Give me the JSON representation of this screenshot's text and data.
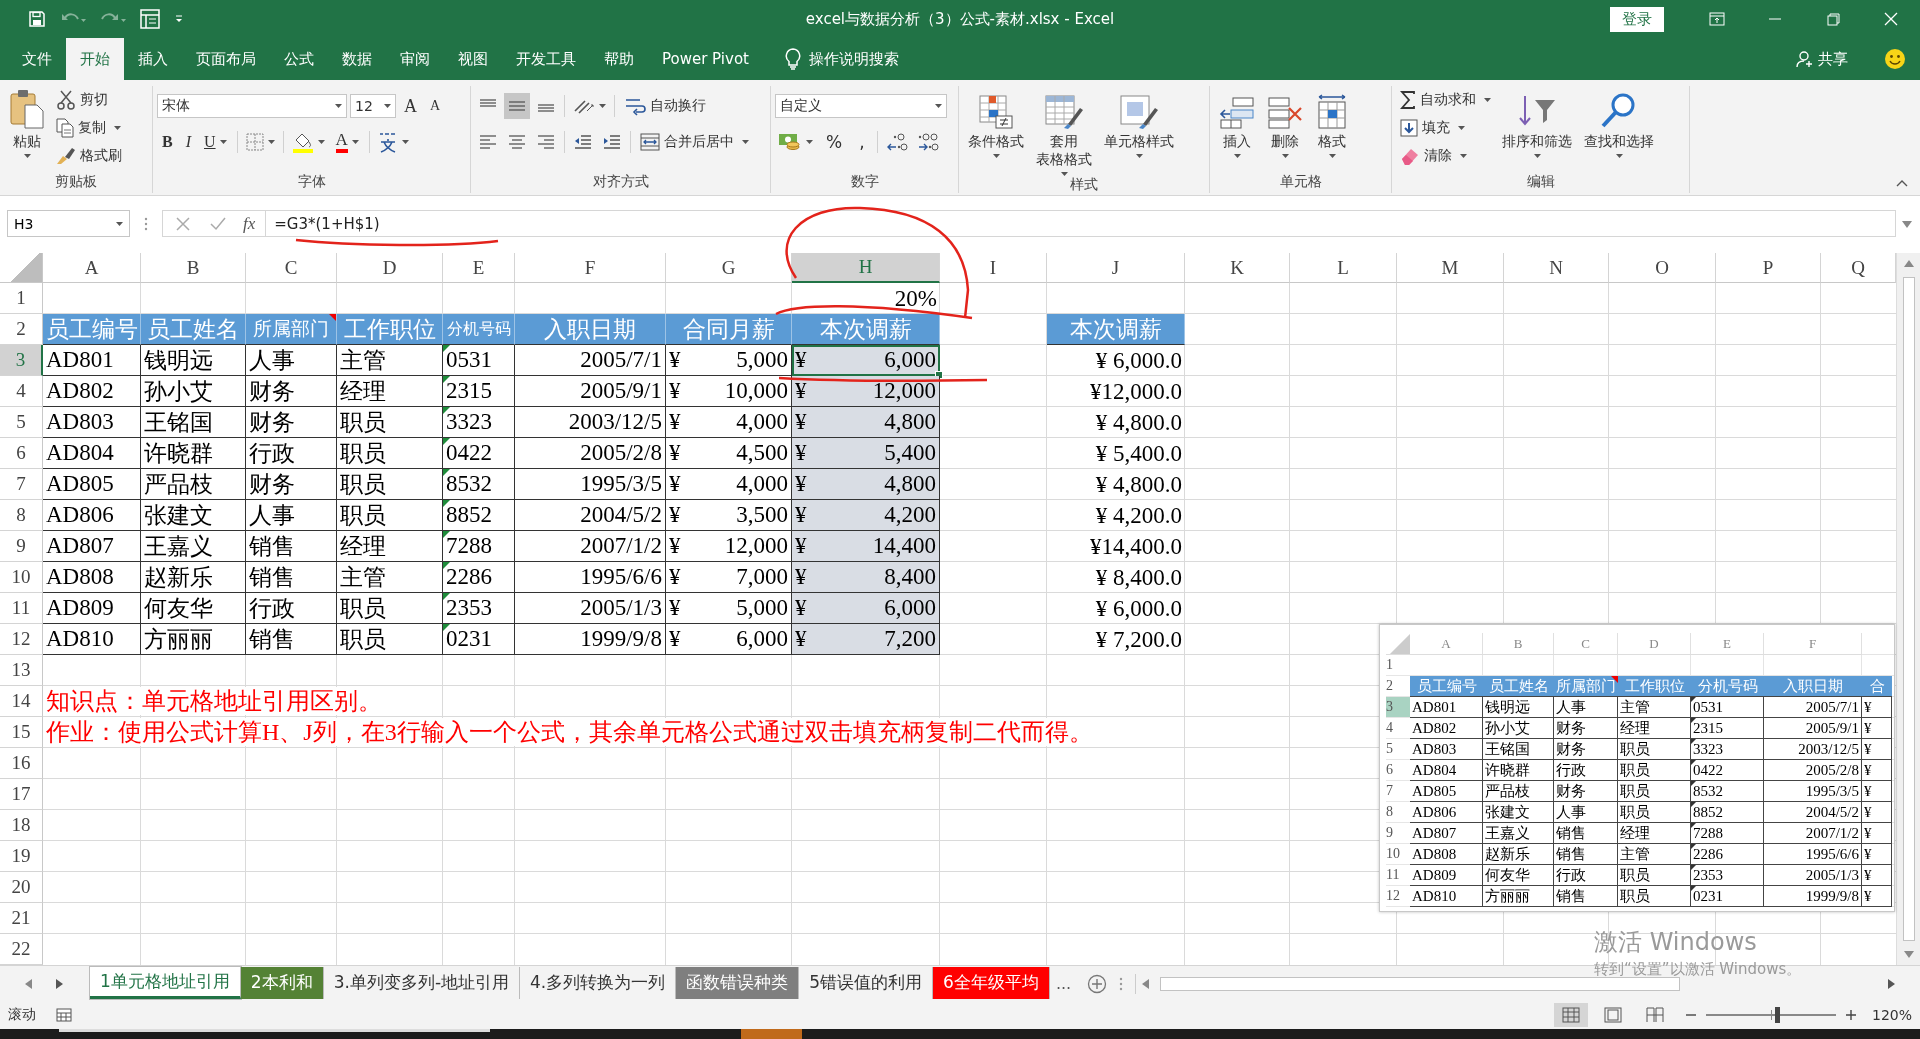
{
  "window": {
    "title": "excel与数据分析（3）公式-素材.xlsx  -  Excel",
    "sign_in": "登录"
  },
  "quick_access": [
    {
      "disabled": false
    },
    {
      "disabled": true
    },
    {
      "disabled": true
    },
    {
      "disabled": false
    }
  ],
  "menu_tabs": [
    {
      "label": "文件",
      "selected": false
    },
    {
      "label": "开始",
      "selected": true
    },
    {
      "label": "插入",
      "selected": false
    },
    {
      "label": "页面布局",
      "selected": false
    },
    {
      "label": "公式",
      "selected": false
    },
    {
      "label": "数据",
      "selected": false
    },
    {
      "label": "审阅",
      "selected": false
    },
    {
      "label": "视图",
      "selected": false
    },
    {
      "label": "开发工具",
      "selected": false
    },
    {
      "label": "帮助",
      "selected": false
    },
    {
      "label": "Power Pivot",
      "selected": false
    }
  ],
  "tell_me": "操作说明搜索",
  "share": "共享",
  "ribbon": {
    "clipboard": {
      "label": "剪贴板",
      "paste": "粘贴",
      "cut": "剪切",
      "copy": "复制",
      "format_painter": "格式刷"
    },
    "font": {
      "label": "字体",
      "font_name": "宋体",
      "font_size": "12",
      "grow": "A",
      "shrink": "A",
      "bold": "B",
      "italic": "I",
      "underline": "U",
      "font_color": "A"
    },
    "alignment": {
      "label": "对齐方式",
      "wrap_text": "自动换行",
      "merge_center": "合并后居中",
      "align_buttons": [
        {
          "selected": false
        },
        {
          "selected": true
        },
        {
          "selected": false
        },
        {
          "selected": false
        },
        {
          "selected": false
        },
        {
          "selected": false
        }
      ]
    },
    "number": {
      "label": "数字",
      "format": "自定义",
      "percent": "%",
      "comma": ","
    },
    "styles": {
      "label": "样式",
      "conditional": "条件格式",
      "table_format": [
        "套用",
        "表格格式"
      ],
      "cell_styles": "单元格样式"
    },
    "cells": {
      "label": "单元格",
      "insert": "插入",
      "delete": "删除",
      "format": "格式"
    },
    "editing": {
      "label": "编辑",
      "autosum": "自动求和",
      "fill": "填充",
      "clear": "清除",
      "sort_filter": "排序和筛选",
      "find_select": "查找和选择"
    }
  },
  "formula_bar": {
    "name_box": "H3",
    "function_label": "fx",
    "formula": "=G3*(1+H$1)"
  },
  "sheet": {
    "columns": [
      {
        "label": "A",
        "selected": false
      },
      {
        "label": "B",
        "selected": false
      },
      {
        "label": "C",
        "selected": false
      },
      {
        "label": "D",
        "selected": false
      },
      {
        "label": "E",
        "selected": false
      },
      {
        "label": "F",
        "selected": false
      },
      {
        "label": "G",
        "selected": false
      },
      {
        "label": "H",
        "selected": true
      },
      {
        "label": "I",
        "selected": false
      },
      {
        "label": "J",
        "selected": false
      },
      {
        "label": "K",
        "selected": false
      },
      {
        "label": "L",
        "selected": false
      },
      {
        "label": "M",
        "selected": false
      },
      {
        "label": "N",
        "selected": false
      },
      {
        "label": "O",
        "selected": false
      },
      {
        "label": "P",
        "selected": false
      },
      {
        "label": "Q",
        "selected": false
      }
    ],
    "rows": [
      {
        "number": "1",
        "selected": false,
        "cells": [
          null,
          null,
          null,
          null,
          null,
          null,
          null,
          {
            "text": "20%",
            "kind": "value",
            "selected": false,
            "active": false
          }
        ]
      },
      {
        "number": "2",
        "selected": false,
        "cells": [
          {
            "text": "员工编号",
            "kind": "header",
            "selected": false,
            "active": false
          },
          {
            "text": "员工姓名",
            "kind": "header",
            "selected": false,
            "active": false
          },
          {
            "text": "所属部门",
            "kind": "annotated",
            "selected": false,
            "active": false
          },
          {
            "text": "工作职位",
            "kind": "header",
            "selected": false,
            "active": false
          },
          {
            "text": "分机号码",
            "kind": "header",
            "selected": false,
            "active": false
          },
          {
            "text": "入职日期",
            "kind": "header",
            "selected": false,
            "active": false
          },
          {
            "text": "合同月薪",
            "kind": "header",
            "selected": false,
            "active": false
          },
          {
            "text": "本次调薪",
            "kind": "header",
            "selected": false,
            "active": false
          },
          null,
          {
            "text": "本次调薪",
            "kind": "header",
            "selected": false,
            "active": false
          }
        ]
      },
      {
        "number": "3",
        "selected": true,
        "cells": [
          {
            "text": "AD801",
            "kind": "text",
            "selected": false,
            "active": false
          },
          {
            "text": "钱明远",
            "kind": "text",
            "selected": false,
            "active": false
          },
          {
            "text": "人事",
            "kind": "text",
            "selected": false,
            "active": false
          },
          {
            "text": "主管",
            "kind": "text",
            "selected": false,
            "active": false
          },
          {
            "text": "0531",
            "kind": "flagged",
            "selected": false,
            "active": false
          },
          {
            "text": "2005/7/1",
            "kind": "number",
            "selected": false,
            "active": false
          },
          {
            "symbol": "¥",
            "text": "5,000",
            "kind": "currency",
            "selected": false,
            "active": false
          },
          {
            "symbol": "¥",
            "text": "6,000",
            "kind": "currency",
            "selected": true,
            "active": true
          },
          null,
          {
            "text": "¥ 6,000.0",
            "kind": "value",
            "selected": false,
            "active": false
          }
        ]
      },
      {
        "number": "4",
        "selected": false,
        "cells": [
          {
            "text": "AD802",
            "kind": "text",
            "selected": false,
            "active": false
          },
          {
            "text": "孙小艾",
            "kind": "text",
            "selected": false,
            "active": false
          },
          {
            "text": "财务",
            "kind": "text",
            "selected": false,
            "active": false
          },
          {
            "text": "经理",
            "kind": "text",
            "selected": false,
            "active": false
          },
          {
            "text": "2315",
            "kind": "flagged",
            "selected": false,
            "active": false
          },
          {
            "text": "2005/9/1",
            "kind": "number",
            "selected": false,
            "active": false
          },
          {
            "symbol": "¥",
            "text": "10,000",
            "kind": "currency",
            "selected": false,
            "active": false
          },
          {
            "symbol": "¥",
            "text": "12,000",
            "kind": "currency",
            "selected": true,
            "active": false
          },
          null,
          {
            "text": "¥12,000.0",
            "kind": "value",
            "selected": false,
            "active": false
          }
        ]
      },
      {
        "number": "5",
        "selected": false,
        "cells": [
          {
            "text": "AD803",
            "kind": "text",
            "selected": false,
            "active": false
          },
          {
            "text": "王铭国",
            "kind": "text",
            "selected": false,
            "active": false
          },
          {
            "text": "财务",
            "kind": "text",
            "selected": false,
            "active": false
          },
          {
            "text": "职员",
            "kind": "text",
            "selected": false,
            "active": false
          },
          {
            "text": "3323",
            "kind": "flagged",
            "selected": false,
            "active": false
          },
          {
            "text": "2003/12/5",
            "kind": "number",
            "selected": false,
            "active": false
          },
          {
            "symbol": "¥",
            "text": "4,000",
            "kind": "currency",
            "selected": false,
            "active": false
          },
          {
            "symbol": "¥",
            "text": "4,800",
            "kind": "currency",
            "selected": true,
            "active": false
          },
          null,
          {
            "text": "¥ 4,800.0",
            "kind": "value",
            "selected": false,
            "active": false
          }
        ]
      },
      {
        "number": "6",
        "selected": false,
        "cells": [
          {
            "text": "AD804",
            "kind": "text",
            "selected": false,
            "active": false
          },
          {
            "text": "许晓群",
            "kind": "text",
            "selected": false,
            "active": false
          },
          {
            "text": "行政",
            "kind": "text",
            "selected": false,
            "active": false
          },
          {
            "text": "职员",
            "kind": "text",
            "selected": false,
            "active": false
          },
          {
            "text": "0422",
            "kind": "flagged",
            "selected": false,
            "active": false
          },
          {
            "text": "2005/2/8",
            "kind": "number",
            "selected": false,
            "active": false
          },
          {
            "symbol": "¥",
            "text": "4,500",
            "kind": "currency",
            "selected": false,
            "active": false
          },
          {
            "symbol": "¥",
            "text": "5,400",
            "kind": "currency",
            "selected": true,
            "active": false
          },
          null,
          {
            "text": "¥ 5,400.0",
            "kind": "value",
            "selected": false,
            "active": false
          }
        ]
      },
      {
        "number": "7",
        "selected": false,
        "cells": [
          {
            "text": "AD805",
            "kind": "text",
            "selected": false,
            "active": false
          },
          {
            "text": "严品枝",
            "kind": "text",
            "selected": false,
            "active": false
          },
          {
            "text": "财务",
            "kind": "text",
            "selected": false,
            "active": false
          },
          {
            "text": "职员",
            "kind": "text",
            "selected": false,
            "active": false
          },
          {
            "text": "8532",
            "kind": "flagged",
            "selected": false,
            "active": false
          },
          {
            "text": "1995/3/5",
            "kind": "number",
            "selected": false,
            "active": false
          },
          {
            "symbol": "¥",
            "text": "4,000",
            "kind": "currency",
            "selected": false,
            "active": false
          },
          {
            "symbol": "¥",
            "text": "4,800",
            "kind": "currency",
            "selected": true,
            "active": false
          },
          null,
          {
            "text": "¥ 4,800.0",
            "kind": "value",
            "selected": false,
            "active": false
          }
        ]
      },
      {
        "number": "8",
        "selected": false,
        "cells": [
          {
            "text": "AD806",
            "kind": "text",
            "selected": false,
            "active": false
          },
          {
            "text": "张建文",
            "kind": "text",
            "selected": false,
            "active": false
          },
          {
            "text": "人事",
            "kind": "text",
            "selected": false,
            "active": false
          },
          {
            "text": "职员",
            "kind": "text",
            "selected": false,
            "active": false
          },
          {
            "text": "8852",
            "kind": "flagged",
            "selected": false,
            "active": false
          },
          {
            "text": "2004/5/2",
            "kind": "number",
            "selected": false,
            "active": false
          },
          {
            "symbol": "¥",
            "text": "3,500",
            "kind": "currency",
            "selected": false,
            "active": false
          },
          {
            "symbol": "¥",
            "text": "4,200",
            "kind": "currency",
            "selected": true,
            "active": false
          },
          null,
          {
            "text": "¥ 4,200.0",
            "kind": "value",
            "selected": false,
            "active": false
          }
        ]
      },
      {
        "number": "9",
        "selected": false,
        "cells": [
          {
            "text": "AD807",
            "kind": "text",
            "selected": false,
            "active": false
          },
          {
            "text": "王嘉义",
            "kind": "text",
            "selected": false,
            "active": false
          },
          {
            "text": "销售",
            "kind": "text",
            "selected": false,
            "active": false
          },
          {
            "text": "经理",
            "kind": "text",
            "selected": false,
            "active": false
          },
          {
            "text": "7288",
            "kind": "flagged",
            "selected": false,
            "active": false
          },
          {
            "text": "2007/1/2",
            "kind": "number",
            "selected": false,
            "active": false
          },
          {
            "symbol": "¥",
            "text": "12,000",
            "kind": "currency",
            "selected": false,
            "active": false
          },
          {
            "symbol": "¥",
            "text": "14,400",
            "kind": "currency",
            "selected": true,
            "active": false
          },
          null,
          {
            "text": "¥14,400.0",
            "kind": "value",
            "selected": false,
            "active": false
          }
        ]
      },
      {
        "number": "10",
        "selected": false,
        "cells": [
          {
            "text": "AD808",
            "kind": "text",
            "selected": false,
            "active": false
          },
          {
            "text": "赵新乐",
            "kind": "text",
            "selected": false,
            "active": false
          },
          {
            "text": "销售",
            "kind": "text",
            "selected": false,
            "active": false
          },
          {
            "text": "主管",
            "kind": "text",
            "selected": false,
            "active": false
          },
          {
            "text": "2286",
            "kind": "flagged",
            "selected": false,
            "active": false
          },
          {
            "text": "1995/6/6",
            "kind": "number",
            "selected": false,
            "active": false
          },
          {
            "symbol": "¥",
            "text": "7,000",
            "kind": "currency",
            "selected": false,
            "active": false
          },
          {
            "symbol": "¥",
            "text": "8,400",
            "kind": "currency",
            "selected": true,
            "active": false
          },
          null,
          {
            "text": "¥ 8,400.0",
            "kind": "value",
            "selected": false,
            "active": false
          }
        ]
      },
      {
        "number": "11",
        "selected": false,
        "cells": [
          {
            "text": "AD809",
            "kind": "text",
            "selected": false,
            "active": false
          },
          {
            "text": "何友华",
            "kind": "text",
            "selected": false,
            "active": false
          },
          {
            "text": "行政",
            "kind": "text",
            "selected": false,
            "active": false
          },
          {
            "text": "职员",
            "kind": "text",
            "selected": false,
            "active": false
          },
          {
            "text": "2353",
            "kind": "flagged",
            "selected": false,
            "active": false
          },
          {
            "text": "2005/1/3",
            "kind": "number",
            "selected": false,
            "active": false
          },
          {
            "symbol": "¥",
            "text": "5,000",
            "kind": "currency",
            "selected": false,
            "active": false
          },
          {
            "symbol": "¥",
            "text": "6,000",
            "kind": "currency",
            "selected": true,
            "active": false
          },
          null,
          {
            "text": "¥ 6,000.0",
            "kind": "value",
            "selected": false,
            "active": false
          }
        ]
      },
      {
        "number": "12",
        "selected": false,
        "cells": [
          {
            "text": "AD810",
            "kind": "text",
            "selected": false,
            "active": false
          },
          {
            "text": "方丽丽",
            "kind": "text",
            "selected": false,
            "active": false
          },
          {
            "text": "销售",
            "kind": "text",
            "selected": false,
            "active": false
          },
          {
            "text": "职员",
            "kind": "text",
            "selected": false,
            "active": false
          },
          {
            "text": "0231",
            "kind": "flagged",
            "selected": false,
            "active": false
          },
          {
            "text": "1999/9/8",
            "kind": "number",
            "selected": false,
            "active": false
          },
          {
            "symbol": "¥",
            "text": "6,000",
            "kind": "currency",
            "selected": false,
            "active": false
          },
          {
            "symbol": "¥",
            "text": "7,200",
            "kind": "currency",
            "selected": true,
            "active": false
          },
          null,
          {
            "text": "¥ 7,200.0",
            "kind": "value",
            "selected": false,
            "active": false
          }
        ]
      },
      {
        "number": "13",
        "selected": false
      },
      {
        "number": "14",
        "selected": false,
        "cells": [
          {
            "text": "知识点：单元格地址引用区别。",
            "kind": "note",
            "selected": false,
            "active": false
          }
        ]
      },
      {
        "number": "15",
        "selected": false,
        "cells": [
          {
            "text": "作业：使用公式计算H、J列，在3行输入一个公式，其余单元格公式通过双击填充柄复制二代而得。",
            "kind": "note",
            "selected": false,
            "active": false
          }
        ]
      },
      {
        "number": "16",
        "selected": false
      },
      {
        "number": "17",
        "selected": false
      },
      {
        "number": "18",
        "selected": false
      },
      {
        "number": "19",
        "selected": false
      },
      {
        "number": "20",
        "selected": false
      },
      {
        "number": "21",
        "selected": false
      },
      {
        "number": "22",
        "selected": false
      }
    ]
  },
  "embedded_screenshot": {
    "columns": [
      "A",
      "B",
      "C",
      "D",
      "E",
      "F"
    ],
    "rows": [
      {
        "number": "1",
        "selected": false
      },
      {
        "number": "2",
        "selected": false,
        "cells": [
          {
            "text": "员工编号",
            "kind": "header"
          },
          {
            "text": "员工姓名",
            "kind": "header"
          },
          {
            "text": "所属部门",
            "kind": "annotated"
          },
          {
            "text": "工作职位",
            "kind": "header"
          },
          {
            "text": "分机号码",
            "kind": "header"
          },
          {
            "text": "入职日期",
            "kind": "header"
          },
          {
            "text": "合",
            "kind": "header"
          }
        ]
      },
      {
        "number": "3",
        "selected": true,
        "cells": [
          {
            "text": "AD801",
            "kind": "text"
          },
          {
            "text": "钱明远",
            "kind": "text"
          },
          {
            "text": "人事",
            "kind": "text"
          },
          {
            "text": "主管",
            "kind": "text"
          },
          {
            "text": "0531",
            "kind": "flagged"
          },
          {
            "text": "2005/7/1",
            "kind": "number"
          },
          {
            "text": "¥",
            "kind": "text"
          }
        ]
      },
      {
        "number": "4",
        "selected": false,
        "cells": [
          {
            "text": "AD802",
            "kind": "text"
          },
          {
            "text": "孙小艾",
            "kind": "text"
          },
          {
            "text": "财务",
            "kind": "text"
          },
          {
            "text": "经理",
            "kind": "text"
          },
          {
            "text": "2315",
            "kind": "flagged"
          },
          {
            "text": "2005/9/1",
            "kind": "number"
          },
          {
            "text": "¥",
            "kind": "text"
          }
        ]
      },
      {
        "number": "5",
        "selected": false,
        "cells": [
          {
            "text": "AD803",
            "kind": "text"
          },
          {
            "text": "王铭国",
            "kind": "text"
          },
          {
            "text": "财务",
            "kind": "text"
          },
          {
            "text": "职员",
            "kind": "text"
          },
          {
            "text": "3323",
            "kind": "flagged"
          },
          {
            "text": "2003/12/5",
            "kind": "number"
          },
          {
            "text": "¥",
            "kind": "text"
          }
        ]
      },
      {
        "number": "6",
        "selected": false,
        "cells": [
          {
            "text": "AD804",
            "kind": "text"
          },
          {
            "text": "许晓群",
            "kind": "text"
          },
          {
            "text": "行政",
            "kind": "text"
          },
          {
            "text": "职员",
            "kind": "text"
          },
          {
            "text": "0422",
            "kind": "flagged"
          },
          {
            "text": "2005/2/8",
            "kind": "number"
          },
          {
            "text": "¥",
            "kind": "text"
          }
        ]
      },
      {
        "number": "7",
        "selected": false,
        "cells": [
          {
            "text": "AD805",
            "kind": "text"
          },
          {
            "text": "严品枝",
            "kind": "text"
          },
          {
            "text": "财务",
            "kind": "text"
          },
          {
            "text": "职员",
            "kind": "text"
          },
          {
            "text": "8532",
            "kind": "flagged"
          },
          {
            "text": "1995/3/5",
            "kind": "number"
          },
          {
            "text": "¥",
            "kind": "text"
          }
        ]
      },
      {
        "number": "8",
        "selected": false,
        "cells": [
          {
            "text": "AD806",
            "kind": "text"
          },
          {
            "text": "张建文",
            "kind": "text"
          },
          {
            "text": "人事",
            "kind": "text"
          },
          {
            "text": "职员",
            "kind": "text"
          },
          {
            "text": "8852",
            "kind": "flagged"
          },
          {
            "text": "2004/5/2",
            "kind": "number"
          },
          {
            "text": "¥",
            "kind": "text"
          }
        ]
      },
      {
        "number": "9",
        "selected": false,
        "cells": [
          {
            "text": "AD807",
            "kind": "text"
          },
          {
            "text": "王嘉义",
            "kind": "text"
          },
          {
            "text": "销售",
            "kind": "text"
          },
          {
            "text": "经理",
            "kind": "text"
          },
          {
            "text": "7288",
            "kind": "flagged"
          },
          {
            "text": "2007/1/2",
            "kind": "number"
          },
          {
            "text": "¥",
            "kind": "text"
          }
        ]
      },
      {
        "number": "10",
        "selected": false,
        "cells": [
          {
            "text": "AD808",
            "kind": "text"
          },
          {
            "text": "赵新乐",
            "kind": "text"
          },
          {
            "text": "销售",
            "kind": "text"
          },
          {
            "text": "主管",
            "kind": "text"
          },
          {
            "text": "2286",
            "kind": "flagged"
          },
          {
            "text": "1995/6/6",
            "kind": "number"
          },
          {
            "text": "¥",
            "kind": "text"
          }
        ]
      },
      {
        "number": "11",
        "selected": false,
        "cells": [
          {
            "text": "AD809",
            "kind": "text"
          },
          {
            "text": "何友华",
            "kind": "text"
          },
          {
            "text": "行政",
            "kind": "text"
          },
          {
            "text": "职员",
            "kind": "text"
          },
          {
            "text": "2353",
            "kind": "flagged"
          },
          {
            "text": "2005/1/3",
            "kind": "number"
          },
          {
            "text": "¥",
            "kind": "text"
          }
        ]
      },
      {
        "number": "12",
        "selected": false,
        "cells": [
          {
            "text": "AD810",
            "kind": "text"
          },
          {
            "text": "方丽丽",
            "kind": "text"
          },
          {
            "text": "销售",
            "kind": "text"
          },
          {
            "text": "职员",
            "kind": "text"
          },
          {
            "text": "0231",
            "kind": "flagged"
          },
          {
            "text": "1999/9/8",
            "kind": "number"
          },
          {
            "text": "¥",
            "kind": "text"
          }
        ]
      }
    ]
  },
  "sheet_tabs": [
    {
      "label": "1单元格地址引用",
      "selected": true
    },
    {
      "label": "2本利和",
      "selected": false,
      "color": "#548235"
    },
    {
      "label": "3.单列变多列-地址引用",
      "selected": false
    },
    {
      "label": "4.多列转换为一列",
      "selected": false
    },
    {
      "label": "函数错误种类",
      "selected": false,
      "color": "#7f7f7f"
    },
    {
      "label": "5错误值的利用",
      "selected": false
    },
    {
      "label": "6全年级平均",
      "selected": false,
      "color": "#ff0000"
    }
  ],
  "more_tabs": "...",
  "activation_notice": {
    "title": "激活 Windows",
    "hint": "转到“设置”以激活 Windows。"
  },
  "status_bar": {
    "mode": "滚动",
    "views": [
      {
        "selected": true
      },
      {
        "selected": false
      },
      {
        "selected": false
      }
    ],
    "zoom": {
      "label": "120%",
      "level": 0.55
    }
  }
}
